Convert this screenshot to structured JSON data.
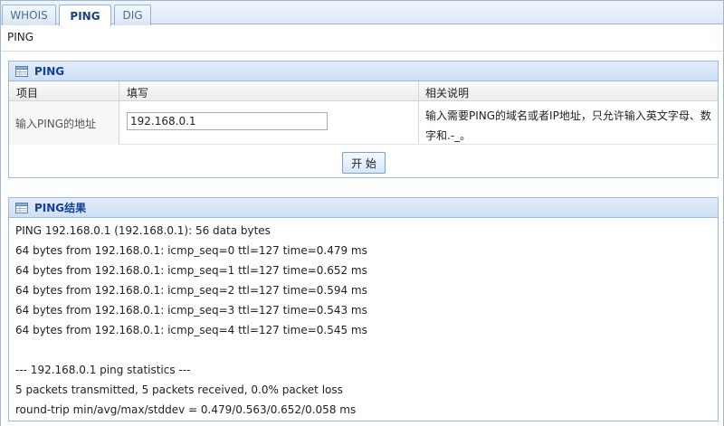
{
  "tabs": [
    {
      "label": "WHOIS",
      "active": false
    },
    {
      "label": "PING",
      "active": true
    },
    {
      "label": "DIG",
      "active": false
    }
  ],
  "page_title": "PING",
  "ping_panel": {
    "title": "PING",
    "columns": {
      "item": "项目",
      "fill": "填写",
      "description": "相关说明"
    },
    "row": {
      "label": "输入PING的地址",
      "value": "192.168.0.1",
      "description": "输入需要PING的域名或者IP地址，只允许输入英文字母、数字和.-_。"
    },
    "start_button": "开 始"
  },
  "result_panel": {
    "title": "PING结果",
    "lines": [
      "PING 192.168.0.1 (192.168.0.1): 56 data bytes",
      "64 bytes from 192.168.0.1: icmp_seq=0 ttl=127 time=0.479 ms",
      "64 bytes from 192.168.0.1: icmp_seq=1 ttl=127 time=0.652 ms",
      "64 bytes from 192.168.0.1: icmp_seq=2 ttl=127 time=0.594 ms",
      "64 bytes from 192.168.0.1: icmp_seq=3 ttl=127 time=0.543 ms",
      "64 bytes from 192.168.0.1: icmp_seq=4 ttl=127 time=0.545 ms",
      "",
      "--- 192.168.0.1 ping statistics ---",
      "5 packets transmitted, 5 packets received, 0.0% packet loss",
      "round-trip min/avg/max/stddev = 0.479/0.563/0.652/0.058 ms"
    ]
  },
  "icons": {
    "panel_icon": "table-icon"
  }
}
